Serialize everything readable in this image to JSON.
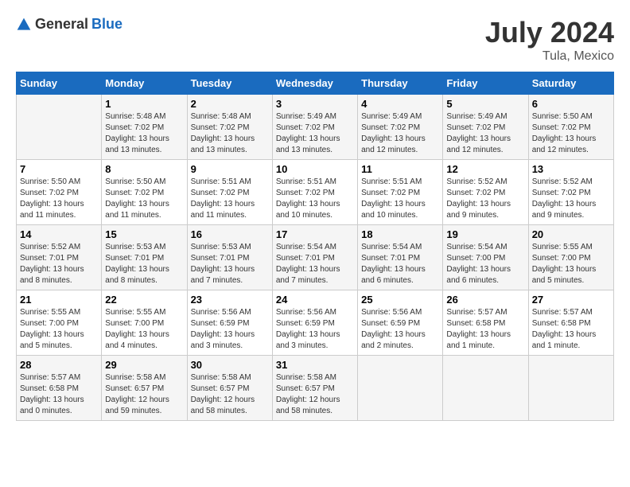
{
  "header": {
    "logo_general": "General",
    "logo_blue": "Blue",
    "month_year": "July 2024",
    "location": "Tula, Mexico"
  },
  "days_of_week": [
    "Sunday",
    "Monday",
    "Tuesday",
    "Wednesday",
    "Thursday",
    "Friday",
    "Saturday"
  ],
  "weeks": [
    [
      {
        "day": "",
        "info": ""
      },
      {
        "day": "1",
        "info": "Sunrise: 5:48 AM\nSunset: 7:02 PM\nDaylight: 13 hours\nand 13 minutes."
      },
      {
        "day": "2",
        "info": "Sunrise: 5:48 AM\nSunset: 7:02 PM\nDaylight: 13 hours\nand 13 minutes."
      },
      {
        "day": "3",
        "info": "Sunrise: 5:49 AM\nSunset: 7:02 PM\nDaylight: 13 hours\nand 13 minutes."
      },
      {
        "day": "4",
        "info": "Sunrise: 5:49 AM\nSunset: 7:02 PM\nDaylight: 13 hours\nand 12 minutes."
      },
      {
        "day": "5",
        "info": "Sunrise: 5:49 AM\nSunset: 7:02 PM\nDaylight: 13 hours\nand 12 minutes."
      },
      {
        "day": "6",
        "info": "Sunrise: 5:50 AM\nSunset: 7:02 PM\nDaylight: 13 hours\nand 12 minutes."
      }
    ],
    [
      {
        "day": "7",
        "info": "Sunrise: 5:50 AM\nSunset: 7:02 PM\nDaylight: 13 hours\nand 11 minutes."
      },
      {
        "day": "8",
        "info": "Sunrise: 5:50 AM\nSunset: 7:02 PM\nDaylight: 13 hours\nand 11 minutes."
      },
      {
        "day": "9",
        "info": "Sunrise: 5:51 AM\nSunset: 7:02 PM\nDaylight: 13 hours\nand 11 minutes."
      },
      {
        "day": "10",
        "info": "Sunrise: 5:51 AM\nSunset: 7:02 PM\nDaylight: 13 hours\nand 10 minutes."
      },
      {
        "day": "11",
        "info": "Sunrise: 5:51 AM\nSunset: 7:02 PM\nDaylight: 13 hours\nand 10 minutes."
      },
      {
        "day": "12",
        "info": "Sunrise: 5:52 AM\nSunset: 7:02 PM\nDaylight: 13 hours\nand 9 minutes."
      },
      {
        "day": "13",
        "info": "Sunrise: 5:52 AM\nSunset: 7:02 PM\nDaylight: 13 hours\nand 9 minutes."
      }
    ],
    [
      {
        "day": "14",
        "info": "Sunrise: 5:52 AM\nSunset: 7:01 PM\nDaylight: 13 hours\nand 8 minutes."
      },
      {
        "day": "15",
        "info": "Sunrise: 5:53 AM\nSunset: 7:01 PM\nDaylight: 13 hours\nand 8 minutes."
      },
      {
        "day": "16",
        "info": "Sunrise: 5:53 AM\nSunset: 7:01 PM\nDaylight: 13 hours\nand 7 minutes."
      },
      {
        "day": "17",
        "info": "Sunrise: 5:54 AM\nSunset: 7:01 PM\nDaylight: 13 hours\nand 7 minutes."
      },
      {
        "day": "18",
        "info": "Sunrise: 5:54 AM\nSunset: 7:01 PM\nDaylight: 13 hours\nand 6 minutes."
      },
      {
        "day": "19",
        "info": "Sunrise: 5:54 AM\nSunset: 7:00 PM\nDaylight: 13 hours\nand 6 minutes."
      },
      {
        "day": "20",
        "info": "Sunrise: 5:55 AM\nSunset: 7:00 PM\nDaylight: 13 hours\nand 5 minutes."
      }
    ],
    [
      {
        "day": "21",
        "info": "Sunrise: 5:55 AM\nSunset: 7:00 PM\nDaylight: 13 hours\nand 5 minutes."
      },
      {
        "day": "22",
        "info": "Sunrise: 5:55 AM\nSunset: 7:00 PM\nDaylight: 13 hours\nand 4 minutes."
      },
      {
        "day": "23",
        "info": "Sunrise: 5:56 AM\nSunset: 6:59 PM\nDaylight: 13 hours\nand 3 minutes."
      },
      {
        "day": "24",
        "info": "Sunrise: 5:56 AM\nSunset: 6:59 PM\nDaylight: 13 hours\nand 3 minutes."
      },
      {
        "day": "25",
        "info": "Sunrise: 5:56 AM\nSunset: 6:59 PM\nDaylight: 13 hours\nand 2 minutes."
      },
      {
        "day": "26",
        "info": "Sunrise: 5:57 AM\nSunset: 6:58 PM\nDaylight: 13 hours\nand 1 minute."
      },
      {
        "day": "27",
        "info": "Sunrise: 5:57 AM\nSunset: 6:58 PM\nDaylight: 13 hours\nand 1 minute."
      }
    ],
    [
      {
        "day": "28",
        "info": "Sunrise: 5:57 AM\nSunset: 6:58 PM\nDaylight: 13 hours\nand 0 minutes."
      },
      {
        "day": "29",
        "info": "Sunrise: 5:58 AM\nSunset: 6:57 PM\nDaylight: 12 hours\nand 59 minutes."
      },
      {
        "day": "30",
        "info": "Sunrise: 5:58 AM\nSunset: 6:57 PM\nDaylight: 12 hours\nand 58 minutes."
      },
      {
        "day": "31",
        "info": "Sunrise: 5:58 AM\nSunset: 6:57 PM\nDaylight: 12 hours\nand 58 minutes."
      },
      {
        "day": "",
        "info": ""
      },
      {
        "day": "",
        "info": ""
      },
      {
        "day": "",
        "info": ""
      }
    ]
  ]
}
